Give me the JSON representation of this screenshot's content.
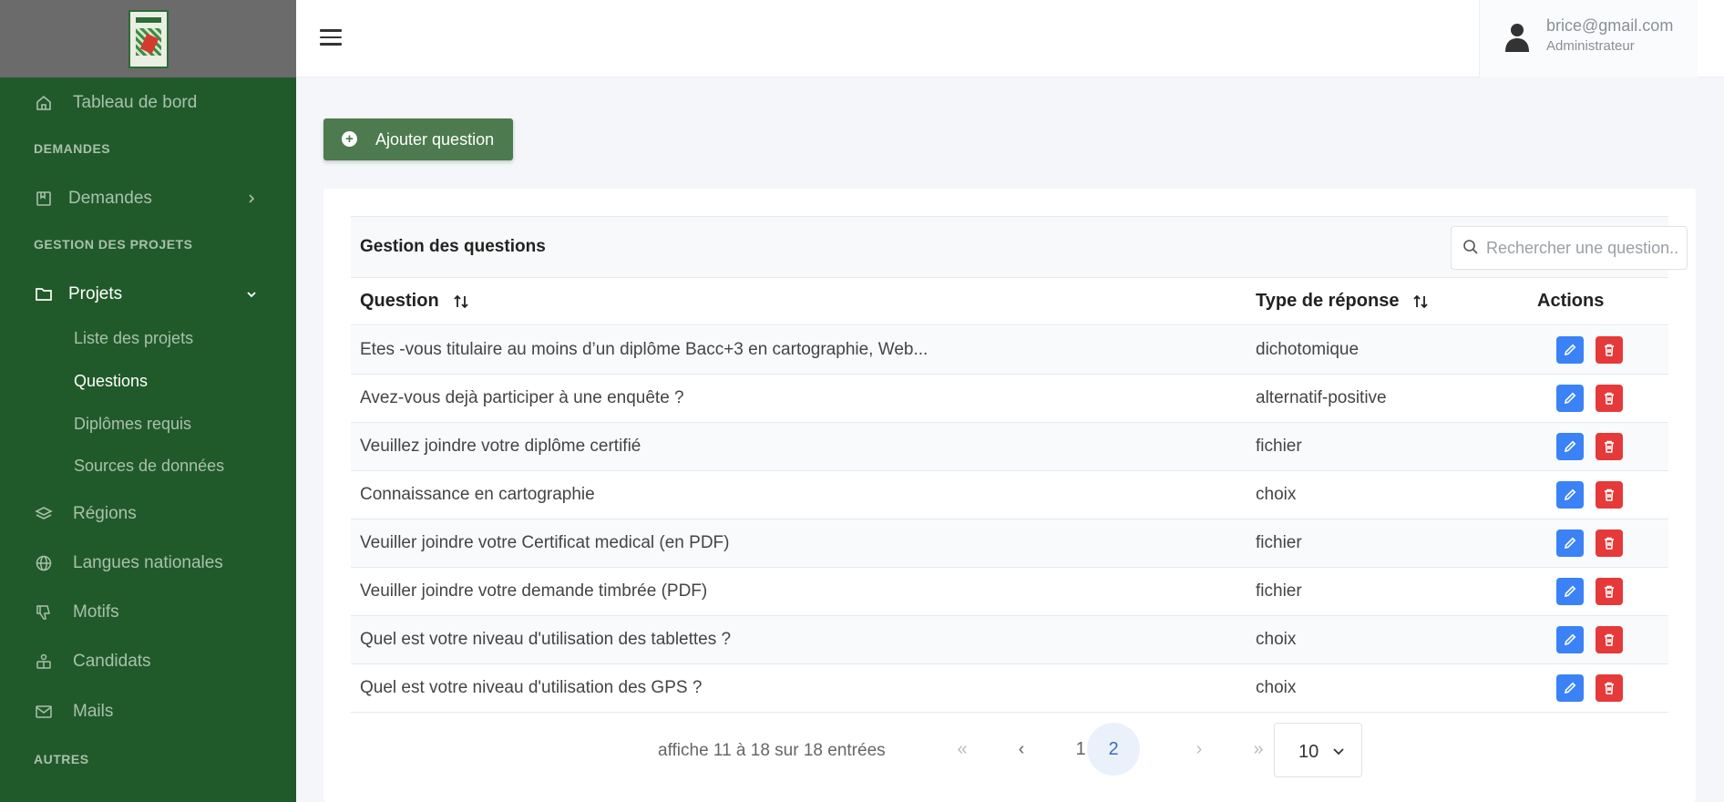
{
  "sidebar": {
    "items": [
      {
        "label": "Tableau de bord",
        "icon": "home-icon"
      },
      {
        "section": "DEMANDES"
      },
      {
        "label": "Demandes",
        "icon": "book-icon"
      },
      {
        "section": "GESTION DES PROJETS"
      },
      {
        "label": "Projets",
        "icon": "folder-icon"
      },
      {
        "label": "Régions",
        "icon": "layers-icon"
      },
      {
        "label": "Langues nationales",
        "icon": "globe-icon"
      },
      {
        "label": "Motifs",
        "icon": "thumbs-down-icon"
      },
      {
        "label": "Candidats",
        "icon": "candidates-icon"
      },
      {
        "label": "Mails",
        "icon": "mail-icon"
      },
      {
        "section": "AUTRES"
      }
    ],
    "projets_sub": [
      "Liste des projets",
      "Questions",
      "Diplômes requis",
      "Sources de données"
    ],
    "active_sub": "Questions"
  },
  "user": {
    "email": "brice@gmail.com",
    "role": "Administrateur"
  },
  "toolbar": {
    "add_label": "Ajouter question"
  },
  "table": {
    "title": "Gestion des questions",
    "search_placeholder": "Rechercher une question...",
    "headers": {
      "question": "Question",
      "type": "Type de réponse",
      "actions": "Actions"
    },
    "rows": [
      {
        "question": "Etes -vous titulaire au moins d’un diplôme Bacc+3 en cartographie, Web...",
        "type": "dichotomique"
      },
      {
        "question": "Avez-vous dejà participer à une enquête ?",
        "type": "alternatif-positive"
      },
      {
        "question": "Veuillez joindre votre diplôme certifié",
        "type": "fichier"
      },
      {
        "question": "Connaissance en cartographie",
        "type": "choix"
      },
      {
        "question": "Veuiller joindre votre Certificat medical (en PDF)",
        "type": "fichier"
      },
      {
        "question": "Veuiller joindre votre demande timbrée (PDF)",
        "type": "fichier"
      },
      {
        "question": "Quel est votre niveau d'utilisation des tablettes ?",
        "type": "choix"
      },
      {
        "question": "Quel est votre niveau d'utilisation des GPS ?",
        "type": "choix"
      }
    ]
  },
  "pagination": {
    "info": "affiche 11 à 18 sur 18 entrées",
    "first": "«",
    "prev": "‹",
    "pages": [
      "1",
      "2"
    ],
    "current": "2",
    "next": "›",
    "last": "»",
    "per_page": "10"
  },
  "colors": {
    "sidebar": "#215a2a",
    "primary_green": "#4d7a4e",
    "edit_blue": "#3b82f6",
    "delete_red": "#e5393a"
  }
}
